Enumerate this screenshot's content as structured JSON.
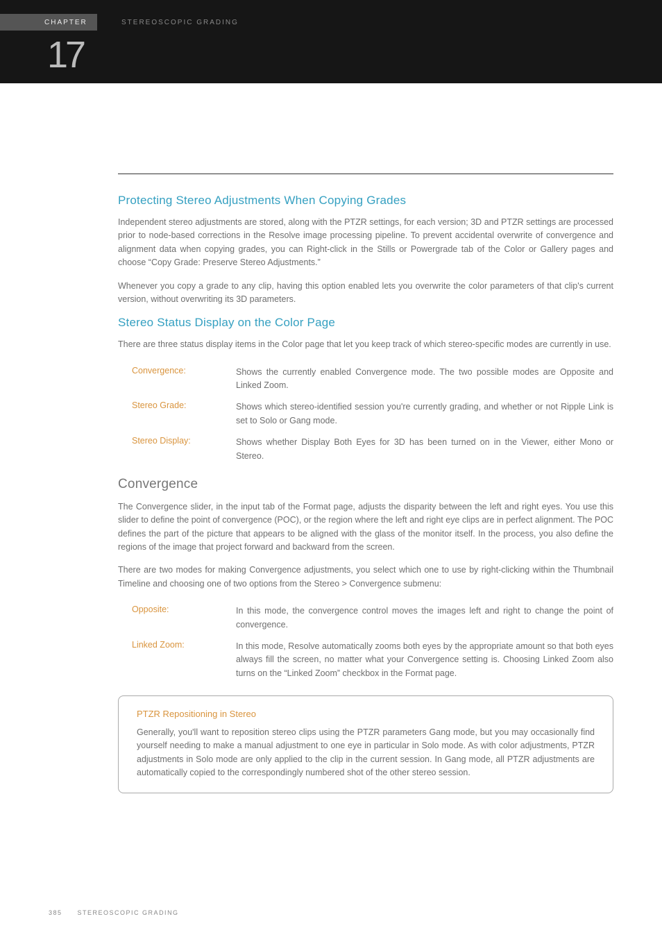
{
  "header": {
    "chapter_label": "CHAPTER",
    "chapter_number": "17",
    "section_title": "STEREOSCOPIC GRADING"
  },
  "section1": {
    "heading": "Protecting Stereo Adjustments When Copying Grades",
    "p1": "Independent stereo adjustments are stored, along with the PTZR settings, for each version; 3D and PTZR settings are processed prior to node-based corrections in the Resolve image processing pipeline. To prevent accidental overwrite of convergence and alignment data when copying grades, you can Right-click in the Stills or Powergrade tab of the Color or Gallery pages and choose “Copy Grade: Preserve Stereo Adjustments.”",
    "p2": "Whenever you copy a grade to any clip, having this option enabled lets you overwrite the color parameters of that clip's current version, without overwriting its 3D parameters."
  },
  "section2": {
    "heading": "Stereo Status Display on the Color Page",
    "intro": "There are three status display items in the Color page that let you keep track of which stereo-specific modes are currently in use.",
    "defs": [
      {
        "term": "Convergence:",
        "desc": "Shows the currently enabled Convergence mode. The two possible modes are Opposite and Linked Zoom."
      },
      {
        "term": "Stereo Grade:",
        "desc": "Shows which stereo-identified session you're currently grading, and whether or not Ripple Link is set to Solo or Gang mode."
      },
      {
        "term": "Stereo Display:",
        "desc": "Shows whether Display Both Eyes for 3D has been turned on in the Viewer, either Mono or Stereo."
      }
    ]
  },
  "section3": {
    "heading": "Convergence",
    "p1": "The Convergence slider, in the input tab of the Format page, adjusts the disparity between the left and right eyes. You use this slider to define the point of convergence (POC), or the region where the left and right eye clips are in perfect alignment. The POC defines the part of the picture that appears to be aligned with the glass of the monitor itself. In the process, you also define the regions of the image that project forward and backward from the screen.",
    "p2": "There are two modes for making Convergence adjustments, you select which one to use by right-clicking within the Thumbnail Timeline and choosing one of two options from the Stereo > Convergence submenu:",
    "defs": [
      {
        "term": "Opposite:",
        "desc": "In this mode, the convergence control moves the images left and right to change the point of convergence."
      },
      {
        "term": "Linked Zoom:",
        "desc": "In this mode, Resolve automatically zooms both eyes by the appropriate amount so that both eyes always fill the screen, no matter what your Convergence setting is. Choosing Linked Zoom also turns on the “Linked Zoom” checkbox in the Format page."
      }
    ]
  },
  "callout": {
    "title": "PTZR Repositioning in Stereo",
    "body": "Generally, you'll want to reposition stereo clips using the PTZR parameters Gang mode, but you may occasionally find yourself needing to make a manual adjustment to one eye in particular in Solo mode. As with color adjustments, PTZR adjustments in Solo mode are only applied to the clip in the current session. In Gang mode, all PTZR adjustments are automatically copied to the correspondingly numbered shot of the other stereo session."
  },
  "footer": {
    "page_number": "385",
    "footer_title": "STEREOSCOPIC GRADING"
  }
}
